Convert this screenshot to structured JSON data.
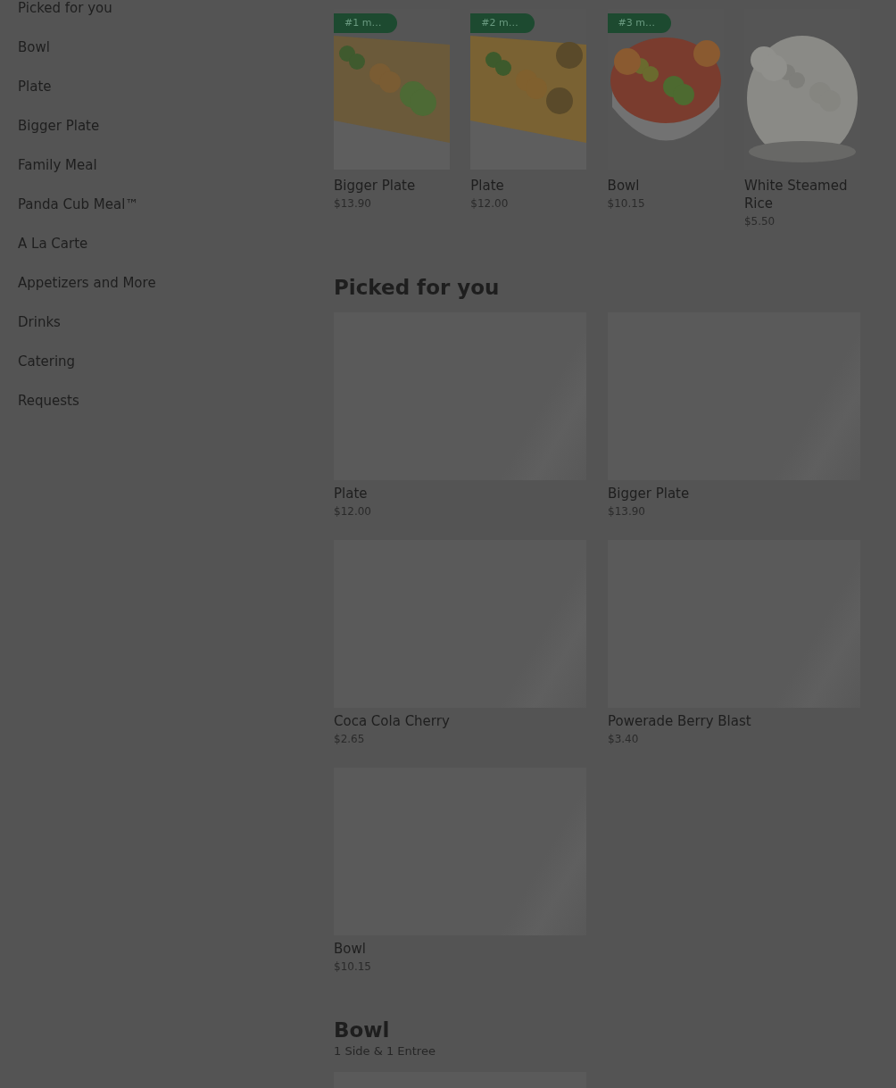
{
  "sidebar": {
    "items": [
      {
        "label": "Picked for you"
      },
      {
        "label": "Bowl"
      },
      {
        "label": "Plate"
      },
      {
        "label": "Bigger Plate"
      },
      {
        "label": "Family Meal"
      },
      {
        "label": "Panda Cub Meal™"
      },
      {
        "label": "A La Carte"
      },
      {
        "label": "Appetizers and More"
      },
      {
        "label": "Drinks"
      },
      {
        "label": "Catering"
      },
      {
        "label": "Requests"
      }
    ]
  },
  "featured": [
    {
      "badge": "#1 m…",
      "name": "Bigger Plate",
      "price": "$13.90"
    },
    {
      "badge": "#2 m…",
      "name": "Plate",
      "price": "$12.00"
    },
    {
      "badge": "#3 m…",
      "name": "Bowl",
      "price": "$10.15"
    },
    {
      "name": "White Steamed Rice",
      "price": "$5.50"
    }
  ],
  "picked_for_you": {
    "title": "Picked for you",
    "items": [
      {
        "name": "Plate",
        "price": "$12.00"
      },
      {
        "name": "Bigger Plate",
        "price": "$13.90"
      },
      {
        "name": "Coca Cola Cherry",
        "price": "$2.65"
      },
      {
        "name": "Powerade Berry Blast",
        "price": "$3.40"
      },
      {
        "name": "Bowl",
        "price": "$10.15"
      }
    ]
  },
  "bowl_section": {
    "title": "Bowl",
    "subtitle": "1 Side & 1 Entree"
  }
}
